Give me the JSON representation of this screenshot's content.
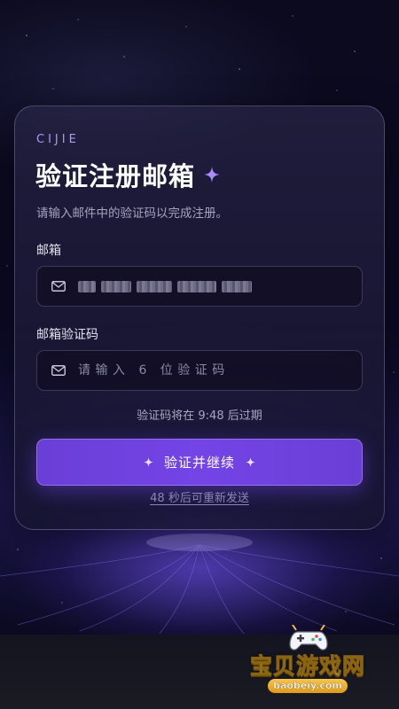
{
  "brand": "CIJIE",
  "title": "验证注册邮箱",
  "subtitle": "请输入邮件中的验证码以完成注册。",
  "email_field": {
    "label": "邮箱",
    "value_masked": true,
    "icon": "mail-icon"
  },
  "code_field": {
    "label": "邮箱验证码",
    "placeholder": "请输入 6 位验证码",
    "value": "",
    "icon": "mail-icon"
  },
  "expiry_text": "验证码将在 9:48 后过期",
  "submit_label": "验证并继续",
  "resend_text": "48 秒后可重新发送",
  "watermark": {
    "text": "宝贝游戏网",
    "url": "baobeiy.com"
  },
  "colors": {
    "accent": "#7444e6",
    "brand_text": "#a99bf2",
    "background": "#07061a"
  }
}
